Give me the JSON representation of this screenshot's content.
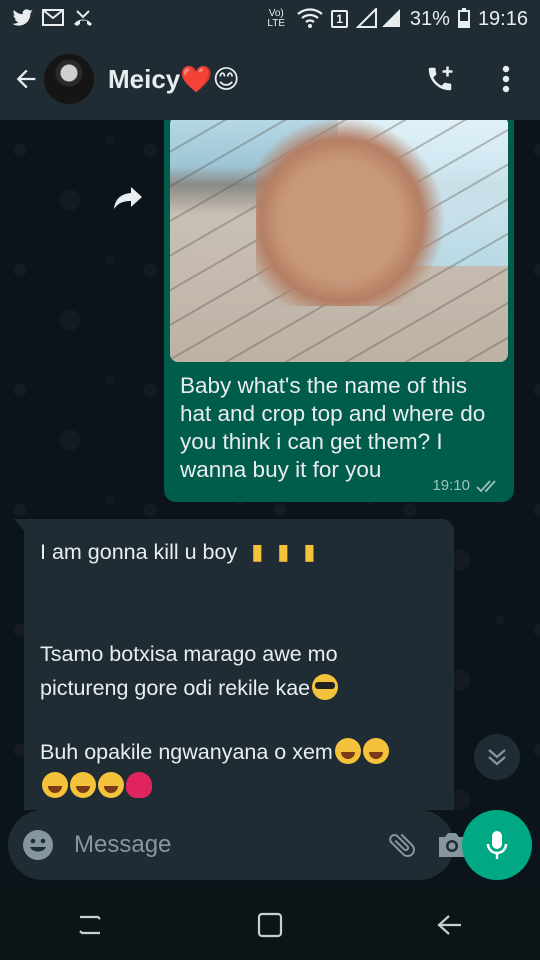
{
  "status_bar": {
    "left_icons": [
      "twitter-icon",
      "gmail-icon",
      "missed-call-icon"
    ],
    "volte": "Vo) LTE",
    "sim_badge": "1",
    "battery": "31%",
    "time": "19:16"
  },
  "header": {
    "contact_name": "Meicy❤️😊",
    "actions": [
      "add-call-icon",
      "more-options-icon"
    ]
  },
  "messages": {
    "outgoing": {
      "text": "Baby what's the name of this hat and crop top and where do you think i can get them? I wanna buy it for you",
      "time": "19:10",
      "status": "read"
    },
    "incoming": {
      "line1": "I am gonna kill u boy",
      "line2": "Tsamo botxisa marago awe mo",
      "line3": "pictureng gore odi rekile kae",
      "line4": "Buh opakile ngwanyana o xem"
    }
  },
  "composer": {
    "placeholder": "Message"
  },
  "colors": {
    "header": "#1f2c34",
    "outgoing_bubble": "#005c4b",
    "incoming_bubble": "#1f2c34",
    "accent": "#00a884",
    "background": "#0b141a"
  }
}
